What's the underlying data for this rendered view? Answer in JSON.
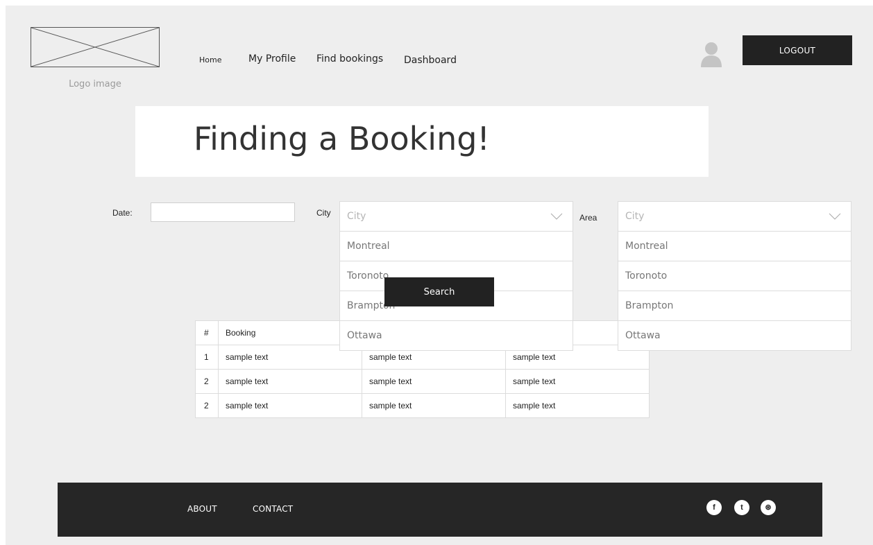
{
  "header": {
    "logo_caption": "Logo image",
    "nav": [
      {
        "label": "Home"
      },
      {
        "label": "My Profile"
      },
      {
        "label": "Find bookings"
      },
      {
        "label": "Dashboard"
      }
    ],
    "logout_label": "LOGOUT"
  },
  "hero": {
    "title": "Finding a Booking!"
  },
  "form": {
    "date_label": "Date:",
    "date_value": "",
    "city_label": "City",
    "area_label": "Area",
    "city_dropdown": {
      "placeholder": "City",
      "options": [
        "Montreal",
        "Toronoto",
        "Brampton",
        "Ottawa"
      ]
    },
    "area_dropdown": {
      "placeholder": "City",
      "options": [
        "Montreal",
        "Toronoto",
        "Brampton",
        "Ottawa"
      ]
    },
    "search_label": "Search"
  },
  "table": {
    "headers": [
      "#",
      "Booking",
      "",
      ""
    ],
    "rows": [
      [
        "1",
        "sample text",
        "sample text",
        "sample text"
      ],
      [
        "2",
        "sample text",
        "sample text",
        "sample text"
      ],
      [
        "2",
        "sample text",
        "sample text",
        "sample text"
      ]
    ]
  },
  "footer": {
    "links": [
      "ABOUT",
      "CONTACT"
    ],
    "social": [
      {
        "icon": "facebook-icon",
        "glyph": "f"
      },
      {
        "icon": "twitter-icon",
        "glyph": "t"
      },
      {
        "icon": "dribbble-icon",
        "glyph": "⊛"
      }
    ]
  },
  "colors": {
    "dark": "#222222",
    "background": "#eeeeee",
    "footer": "#262626"
  }
}
